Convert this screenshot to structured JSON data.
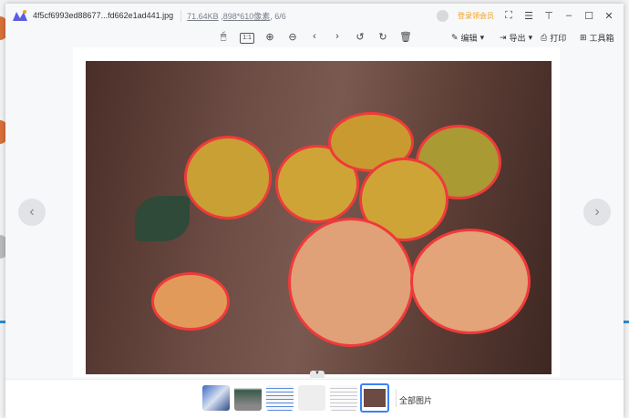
{
  "title": {
    "filename": "4f5cf6993ed88677...fd662e1ad441.jpg",
    "filesize": "71.64KB",
    "dimensions": "898*610像素",
    "index": ", 6/6",
    "vip_label": "登录领会员"
  },
  "toolbar": {
    "edit": "编辑",
    "export": "导出",
    "print": "打印",
    "toolbox": "工具箱",
    "actual_size": "1:1"
  },
  "strip": {
    "all_images": "全部图片",
    "selected_index": 6
  }
}
